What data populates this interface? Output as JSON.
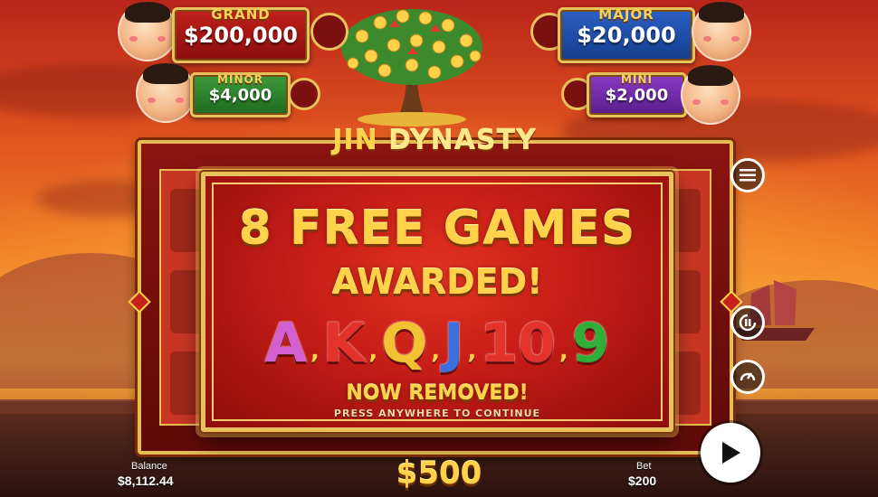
{
  "jackpots": {
    "grand": {
      "label": "GRAND",
      "value": "$200,000"
    },
    "minor": {
      "label": "MINOR",
      "value": "$4,000"
    },
    "major": {
      "label": "MAJOR",
      "value": "$20,000"
    },
    "mini": {
      "label": "MINI",
      "value": "$2,000"
    }
  },
  "logo": {
    "part1": "JIN",
    "part2": "DYNASTY"
  },
  "popup": {
    "headline": "8 FREE GAMES",
    "subhead": "AWARDED!",
    "symbols": [
      "A",
      "K",
      "Q",
      "J",
      "10",
      "9"
    ],
    "separator": ",",
    "removed_text": "NOW REMOVED!",
    "continue_text": "PRESS ANYWHERE TO CONTINUE"
  },
  "footer": {
    "balance_label": "Balance",
    "balance_value": "$8,112.44",
    "win_value": "$500",
    "bet_label": "Bet",
    "bet_value": "$200"
  },
  "controls": [
    "menu-icon",
    "autoplay-icon",
    "turbo-icon",
    "play-icon"
  ],
  "colors": {
    "gold": "#ffd24a",
    "frame_red": "#8a1410",
    "grand_bg": "#c1201a",
    "minor_bg": "#3d9a3a",
    "major_bg": "#2b5fc4",
    "mini_bg": "#8a3ac4",
    "symbol_A": "#d45fd0",
    "symbol_K": "#e3332a",
    "symbol_Q": "#f1c232",
    "symbol_J": "#3a6fe0",
    "symbol_10": "#e3332a",
    "symbol_9": "#2fae3a"
  }
}
